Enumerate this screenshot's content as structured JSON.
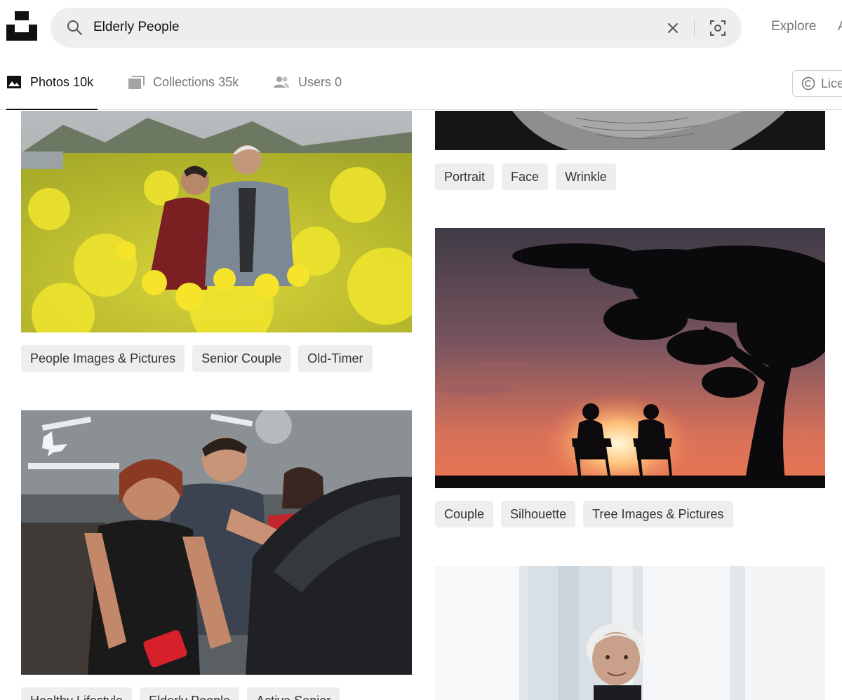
{
  "header": {
    "logo_icon": "unsplash-logo-icon",
    "search": {
      "value": "Elderly People",
      "icons": [
        "search-icon",
        "close-icon",
        "visual-search-icon"
      ]
    },
    "nav": {
      "explore": "Explore",
      "next": "A"
    }
  },
  "tabs": [
    {
      "label": "Photos",
      "count": "10k",
      "icon": "image-icon",
      "active": true
    },
    {
      "label": "Collections",
      "count": "35k",
      "icon": "collections-icon",
      "active": false
    },
    {
      "label": "Users",
      "count": "0",
      "icon": "users-icon",
      "active": false
    }
  ],
  "license": {
    "label": "Lice",
    "icon": "copyright-icon"
  },
  "results": {
    "left_column": [
      {
        "name": "senior-couple-flower-field",
        "tags": [
          "People Images & Pictures",
          "Senior Couple",
          "Old-Timer"
        ]
      },
      {
        "name": "woman-exercise-bike-gym",
        "tags": [
          "Healthy Lifestyle",
          "Elderly People",
          "Active Senior"
        ]
      }
    ],
    "right_column": [
      {
        "name": "wrinkled-skin-closeup",
        "tags": [
          "Portrait",
          "Face",
          "Wrinkle"
        ]
      },
      {
        "name": "couple-silhouette-sunset",
        "tags": [
          "Couple",
          "Silhouette",
          "Tree Images & Pictures"
        ]
      },
      {
        "name": "elderly-woman-window",
        "tags": []
      }
    ]
  },
  "colors": {
    "field": "#eeeeee",
    "tag_bg": "#eeeeee",
    "muted_text": "#767676",
    "text": "#111111"
  }
}
